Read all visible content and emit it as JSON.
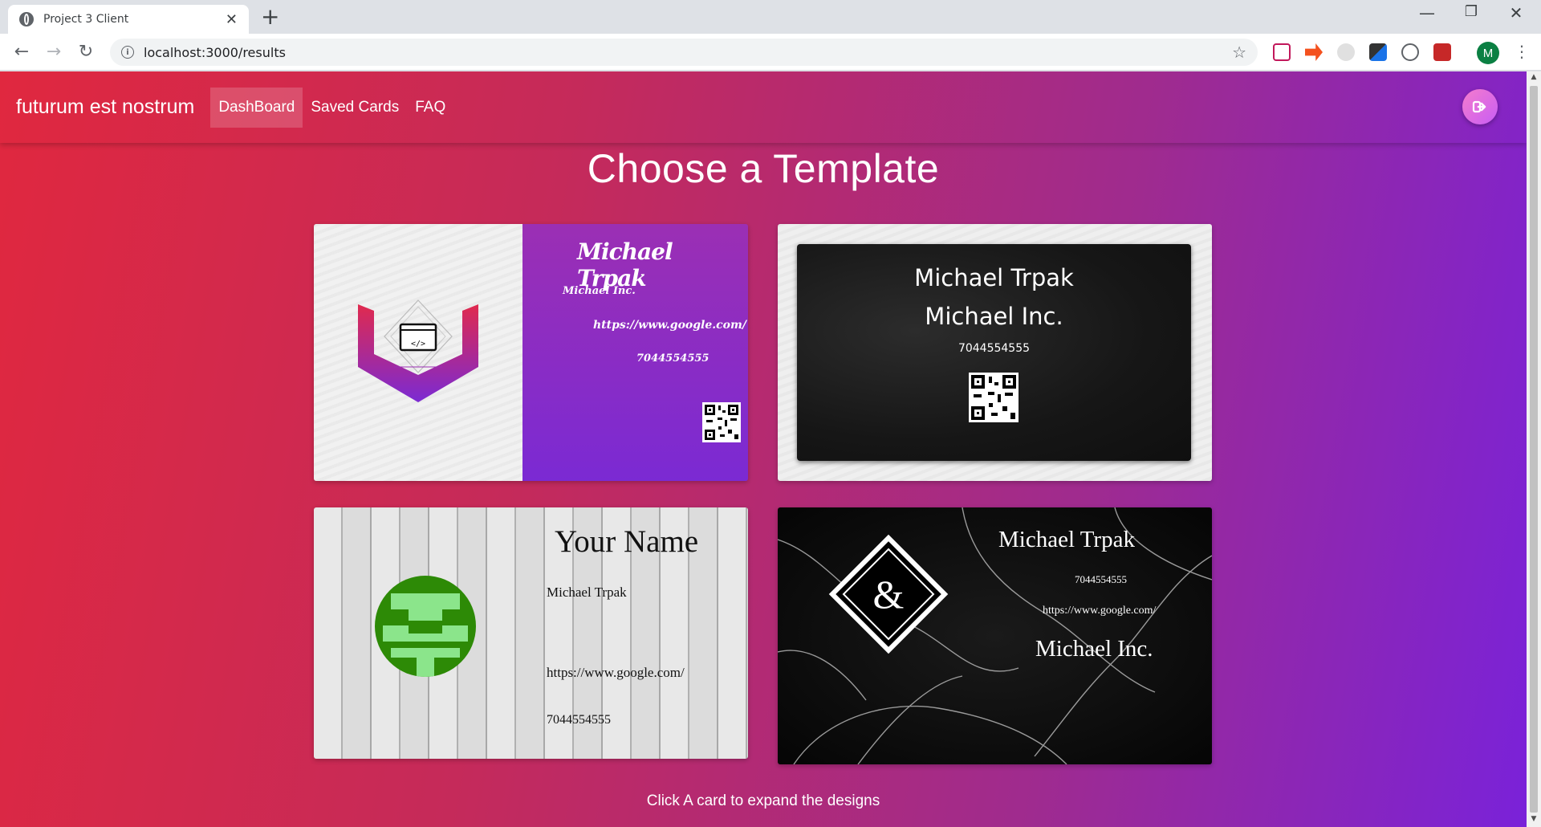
{
  "browser": {
    "tab_title": "Project 3 Client",
    "tab_close": "✕",
    "new_tab": "+",
    "url": "localhost:3000/results",
    "window_controls": {
      "minimize": "—",
      "restore": "❐",
      "close": "✕"
    },
    "avatar_letter": "M"
  },
  "app": {
    "brand": "futurum est nostrum",
    "nav": [
      {
        "label": "DashBoard",
        "active": true
      },
      {
        "label": "Saved Cards",
        "active": false
      },
      {
        "label": "FAQ",
        "active": false
      }
    ],
    "heading": "Choose a Template",
    "footer_hint": "Click A card to expand the designs"
  },
  "cards": {
    "card1": {
      "name": "Michael Trpak",
      "company": "Michael Inc.",
      "url": "https://www.google.com/",
      "phone": "7044554555"
    },
    "card2": {
      "name": "Michael Trpak",
      "company": "Michael Inc.",
      "phone": "7044554555"
    },
    "card3": {
      "title": "Your Name",
      "name": "Michael Trpak",
      "url": "https://www.google.com/",
      "phone": "7044554555"
    },
    "card4": {
      "name": "Michael Trpak",
      "phone": "7044554555",
      "url": "https://www.google.com/",
      "company": "Michael Inc.",
      "monogram": "&"
    }
  },
  "colors": {
    "gradient_start": "#e0283f",
    "gradient_end": "#7a22d9",
    "card1_purple": "#8b2cc4",
    "card3_avatar": "#2d8a06"
  }
}
